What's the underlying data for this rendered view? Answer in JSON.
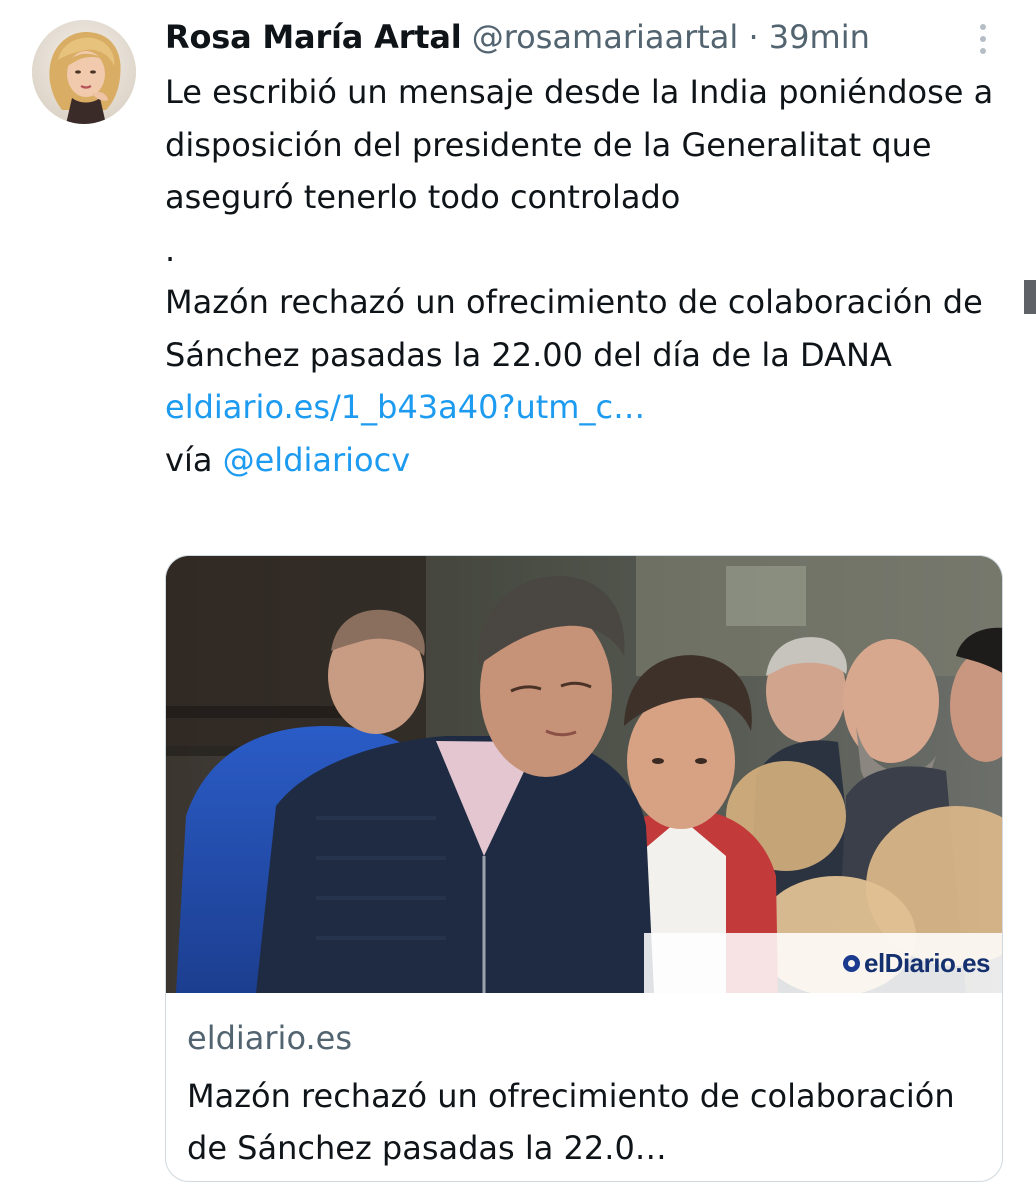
{
  "author": {
    "display_name": "Rosa María Artal",
    "handle": "@rosamariaartal",
    "separator": "·",
    "time_ago": "39min"
  },
  "tweet": {
    "paragraphs": [
      "Le escribió un mensaje desde la India poniéndose a disposición del presidente de la Generalitat que aseguró tenerlo todo controlado",
      "."
    ],
    "headline_text": "Mazón rechazó un ofrecimiento de colaboración de Sánchez pasadas la 22.00 del día de la DANA",
    "link_text": "eldiario.es/1_b43a40?utm_c…",
    "via_label": "vía",
    "mention": "@eldiariocv"
  },
  "link_card": {
    "image_watermark": "elDiario.es",
    "domain": "eldiario.es",
    "title": "Mazón rechazó un ofrecimiento de colaboración de Sánchez pasadas la 22.0…"
  },
  "icons": {
    "more": "more-vertical-icon",
    "avatar": "profile-avatar"
  },
  "colors": {
    "text_primary": "#0f1419",
    "text_secondary": "#536471",
    "link": "#1d9bf0",
    "card_border": "#cfd9de",
    "watermark_blue": "#14306f"
  }
}
